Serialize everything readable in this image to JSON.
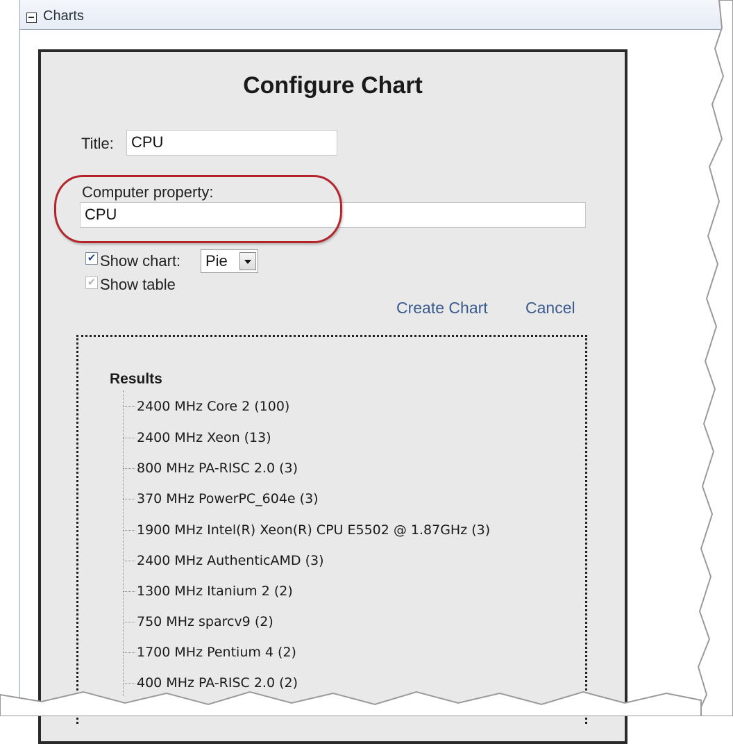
{
  "section": {
    "title": "Charts"
  },
  "dialog": {
    "title": "Configure Chart",
    "title_label": "Title:",
    "title_value": "CPU",
    "property_label": "Computer property:",
    "property_value": "CPU",
    "show_chart_label": "Show chart:",
    "show_chart_checked": true,
    "chart_type": "Pie",
    "show_table_label": "Show table",
    "show_table_checked": true,
    "create_label": "Create Chart",
    "cancel_label": "Cancel"
  },
  "results": {
    "title": "Results",
    "items": [
      "2400 MHz Core 2 (100)",
      "2400 MHz Xeon (13)",
      "800 MHz PA-RISC 2.0 (3)",
      "370 MHz PowerPC_604e (3)",
      "1900 MHz Intel(R) Xeon(R) CPU E5502 @ 1.87GHz (3)",
      "2400 MHz AuthenticAMD (3)",
      "1300 MHz Itanium 2 (2)",
      "750 MHz sparcv9 (2)",
      "1700 MHz Pentium 4 (2)",
      "400 MHz PA-RISC 2.0 (2)"
    ]
  },
  "colors": {
    "highlight": "#b3252b",
    "link": "#3a5a8e"
  }
}
